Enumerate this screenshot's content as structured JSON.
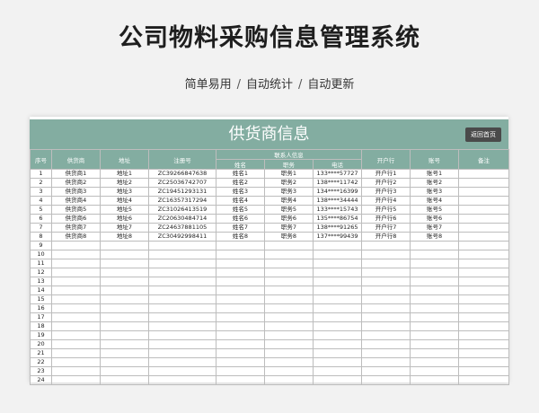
{
  "page": {
    "title": "公司物料采购信息管理系统",
    "subtitle_parts": [
      "简单易用",
      "自动统计",
      "自动更新"
    ],
    "separator": "/"
  },
  "sheet": {
    "title": "供货商信息",
    "back_button": "返回首页",
    "header_color": "#83ada1",
    "columns": [
      "序号",
      "供货商",
      "地址",
      "注册号",
      "联系人信息",
      "开户行",
      "账号",
      "备注"
    ],
    "contact_sub_columns": [
      "姓名",
      "职务",
      "电话"
    ],
    "rows": [
      [
        "1",
        "供货商1",
        "地址1",
        "ZC39266847638",
        "姓名1",
        "职务1",
        "133****57727",
        "开户行1",
        "账号1",
        ""
      ],
      [
        "2",
        "供货商2",
        "地址2",
        "ZC25036742707",
        "姓名2",
        "职务2",
        "138****11742",
        "开户行2",
        "账号2",
        ""
      ],
      [
        "3",
        "供货商3",
        "地址3",
        "ZC19451293131",
        "姓名3",
        "职务3",
        "134****16399",
        "开户行3",
        "账号3",
        ""
      ],
      [
        "4",
        "供货商4",
        "地址4",
        "ZC16357317294",
        "姓名4",
        "职务4",
        "138****34444",
        "开户行4",
        "账号4",
        ""
      ],
      [
        "5",
        "供货商5",
        "地址5",
        "ZC31026413519",
        "姓名5",
        "职务5",
        "133****15743",
        "开户行5",
        "账号5",
        ""
      ],
      [
        "6",
        "供货商6",
        "地址6",
        "ZC20630484714",
        "姓名6",
        "职务6",
        "135****86754",
        "开户行6",
        "账号6",
        ""
      ],
      [
        "7",
        "供货商7",
        "地址7",
        "ZC24637881105",
        "姓名7",
        "职务7",
        "138****91265",
        "开户行7",
        "账号7",
        ""
      ],
      [
        "8",
        "供货商8",
        "地址8",
        "ZC30492998411",
        "姓名8",
        "职务8",
        "137****99439",
        "开户行8",
        "账号8",
        ""
      ],
      [
        "9",
        "",
        "",
        "",
        "",
        "",
        "",
        "",
        "",
        ""
      ],
      [
        "10",
        "",
        "",
        "",
        "",
        "",
        "",
        "",
        "",
        ""
      ],
      [
        "11",
        "",
        "",
        "",
        "",
        "",
        "",
        "",
        "",
        ""
      ],
      [
        "12",
        "",
        "",
        "",
        "",
        "",
        "",
        "",
        "",
        ""
      ],
      [
        "13",
        "",
        "",
        "",
        "",
        "",
        "",
        "",
        "",
        ""
      ],
      [
        "14",
        "",
        "",
        "",
        "",
        "",
        "",
        "",
        "",
        ""
      ],
      [
        "15",
        "",
        "",
        "",
        "",
        "",
        "",
        "",
        "",
        ""
      ],
      [
        "16",
        "",
        "",
        "",
        "",
        "",
        "",
        "",
        "",
        ""
      ],
      [
        "17",
        "",
        "",
        "",
        "",
        "",
        "",
        "",
        "",
        ""
      ],
      [
        "18",
        "",
        "",
        "",
        "",
        "",
        "",
        "",
        "",
        ""
      ],
      [
        "19",
        "",
        "",
        "",
        "",
        "",
        "",
        "",
        "",
        ""
      ],
      [
        "20",
        "",
        "",
        "",
        "",
        "",
        "",
        "",
        "",
        ""
      ],
      [
        "21",
        "",
        "",
        "",
        "",
        "",
        "",
        "",
        "",
        ""
      ],
      [
        "22",
        "",
        "",
        "",
        "",
        "",
        "",
        "",
        "",
        ""
      ],
      [
        "23",
        "",
        "",
        "",
        "",
        "",
        "",
        "",
        "",
        ""
      ],
      [
        "24",
        "",
        "",
        "",
        "",
        "",
        "",
        "",
        "",
        ""
      ]
    ]
  }
}
